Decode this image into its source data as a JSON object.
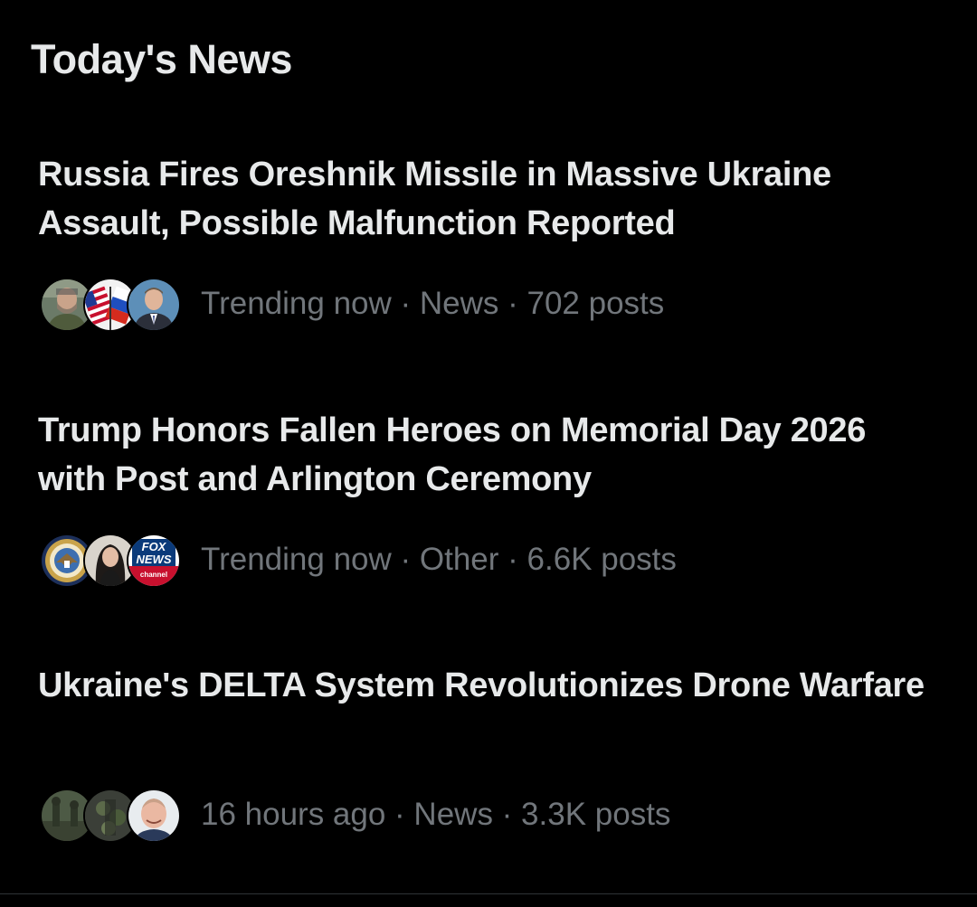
{
  "section": {
    "title": "Today's News"
  },
  "stories": [
    {
      "headline": "Russia Fires Oreshnik Missile in Massive Ukraine Assault, Possible Malfunction Reported",
      "meta": "Trending now · News · 702 posts",
      "avatars": [
        "bearded-man-avatar",
        "us-russia-flags-avatar",
        "man-in-suit-avatar"
      ]
    },
    {
      "headline": "Trump Honors Fallen Heroes on Memorial Day 2026 with Post and Arlington Ceremony",
      "meta": "Trending now · Other · 6.6K posts",
      "avatars": [
        "department-seal-avatar",
        "woman-portrait-avatar",
        "fox-news-logo-avatar"
      ],
      "logo_text": [
        "FOX",
        "NEWS",
        "channel"
      ]
    },
    {
      "headline": "Ukraine's DELTA System Revolutionizes Drone Warfare",
      "meta": "16 hours ago · News · 3.3K posts",
      "avatars": [
        "soldiers-field-avatar",
        "soldier-camo-avatar",
        "smiling-man-avatar"
      ]
    }
  ],
  "colors": {
    "background": "#000000",
    "headline": "#e7e9ea",
    "meta": "#71767b",
    "divider": "#2f3336"
  }
}
